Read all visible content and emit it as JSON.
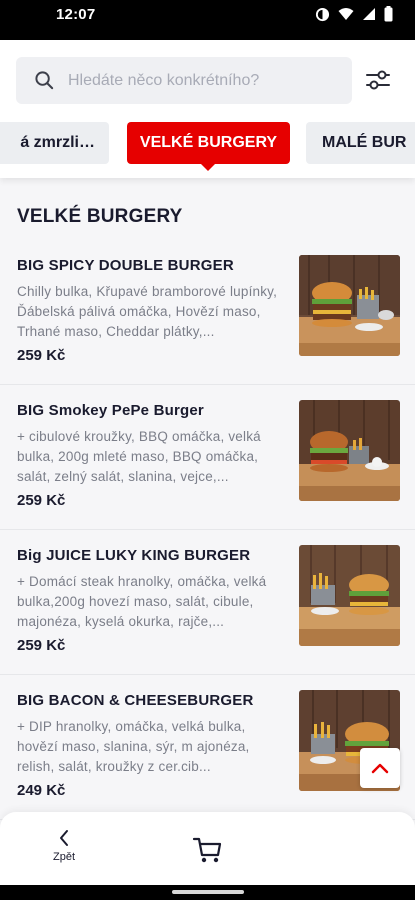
{
  "status_bar": {
    "time": "12:07"
  },
  "search": {
    "placeholder": "Hledáte něco konkrétního?"
  },
  "categories": {
    "prev": "á zmrzli…",
    "active": "VELKÉ BURGERY",
    "next": "MALÉ BUR"
  },
  "section": {
    "title": "VELKÉ BURGERY"
  },
  "items": [
    {
      "name": "BIG SPICY DOUBLE BURGER",
      "description": "Chilly bulka, Křupavé bramborové lupínky, Ďábelská pálivá omáčka, Hovězí maso, Trhané maso, Cheddar plátky,...",
      "price": "259 Kč"
    },
    {
      "name": "BIG Smokey PePe Burger",
      "description": "+ cibulové kroužky, BBQ omáčka, velká bulka, 200g mleté maso, BBQ omáčka, salát, zelný salát, slanina, vejce,...",
      "price": "259 Kč"
    },
    {
      "name": "Big JUICE LUKY KING BURGER",
      "description": "+ Domácí steak hranolky, omáčka, velká bulka,200g hovezí maso, salát, cibule, majonéza, kyselá okurka, rajče,...",
      "price": "259 Kč"
    },
    {
      "name": "BIG BACON & CHEESEBURGER",
      "description": "+ DIP hranolky, omáčka, velká bulka, hovězí maso, slanina, sýr, m ajonéza, relish, salát, kroužky z cer.cib...",
      "price": "249 Kč"
    }
  ],
  "bottom_bar": {
    "back_label": "Zpět"
  },
  "colors": {
    "accent": "#e60000",
    "text": "#1a1b2e",
    "muted": "#7b7e89"
  },
  "icons": [
    "search-icon",
    "filter-icon",
    "chevron-up-icon",
    "chevron-left-icon",
    "cart-icon",
    "wifi-icon",
    "signal-icon",
    "battery-icon"
  ]
}
